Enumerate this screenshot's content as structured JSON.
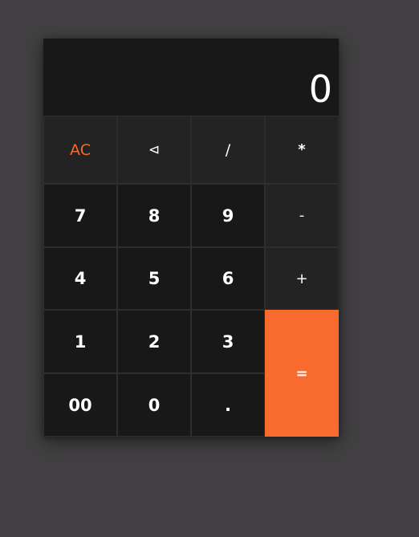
{
  "display": {
    "value": "0"
  },
  "keys": {
    "clear": "AC",
    "backspace": "⊲",
    "divide": "/",
    "multiply": "*",
    "seven": "7",
    "eight": "8",
    "nine": "9",
    "subtract": "-",
    "four": "4",
    "five": "5",
    "six": "6",
    "add": "+",
    "one": "1",
    "two": "2",
    "three": "3",
    "equals": "=",
    "double_zero": "00",
    "zero": "0",
    "decimal": "."
  },
  "colors": {
    "background": "#424042",
    "accent": "#f96a2e",
    "display_bg": "#181818",
    "key_dark": "#181818",
    "key_func": "#232323"
  },
  "icons": {
    "backspace": "backspace-icon"
  }
}
